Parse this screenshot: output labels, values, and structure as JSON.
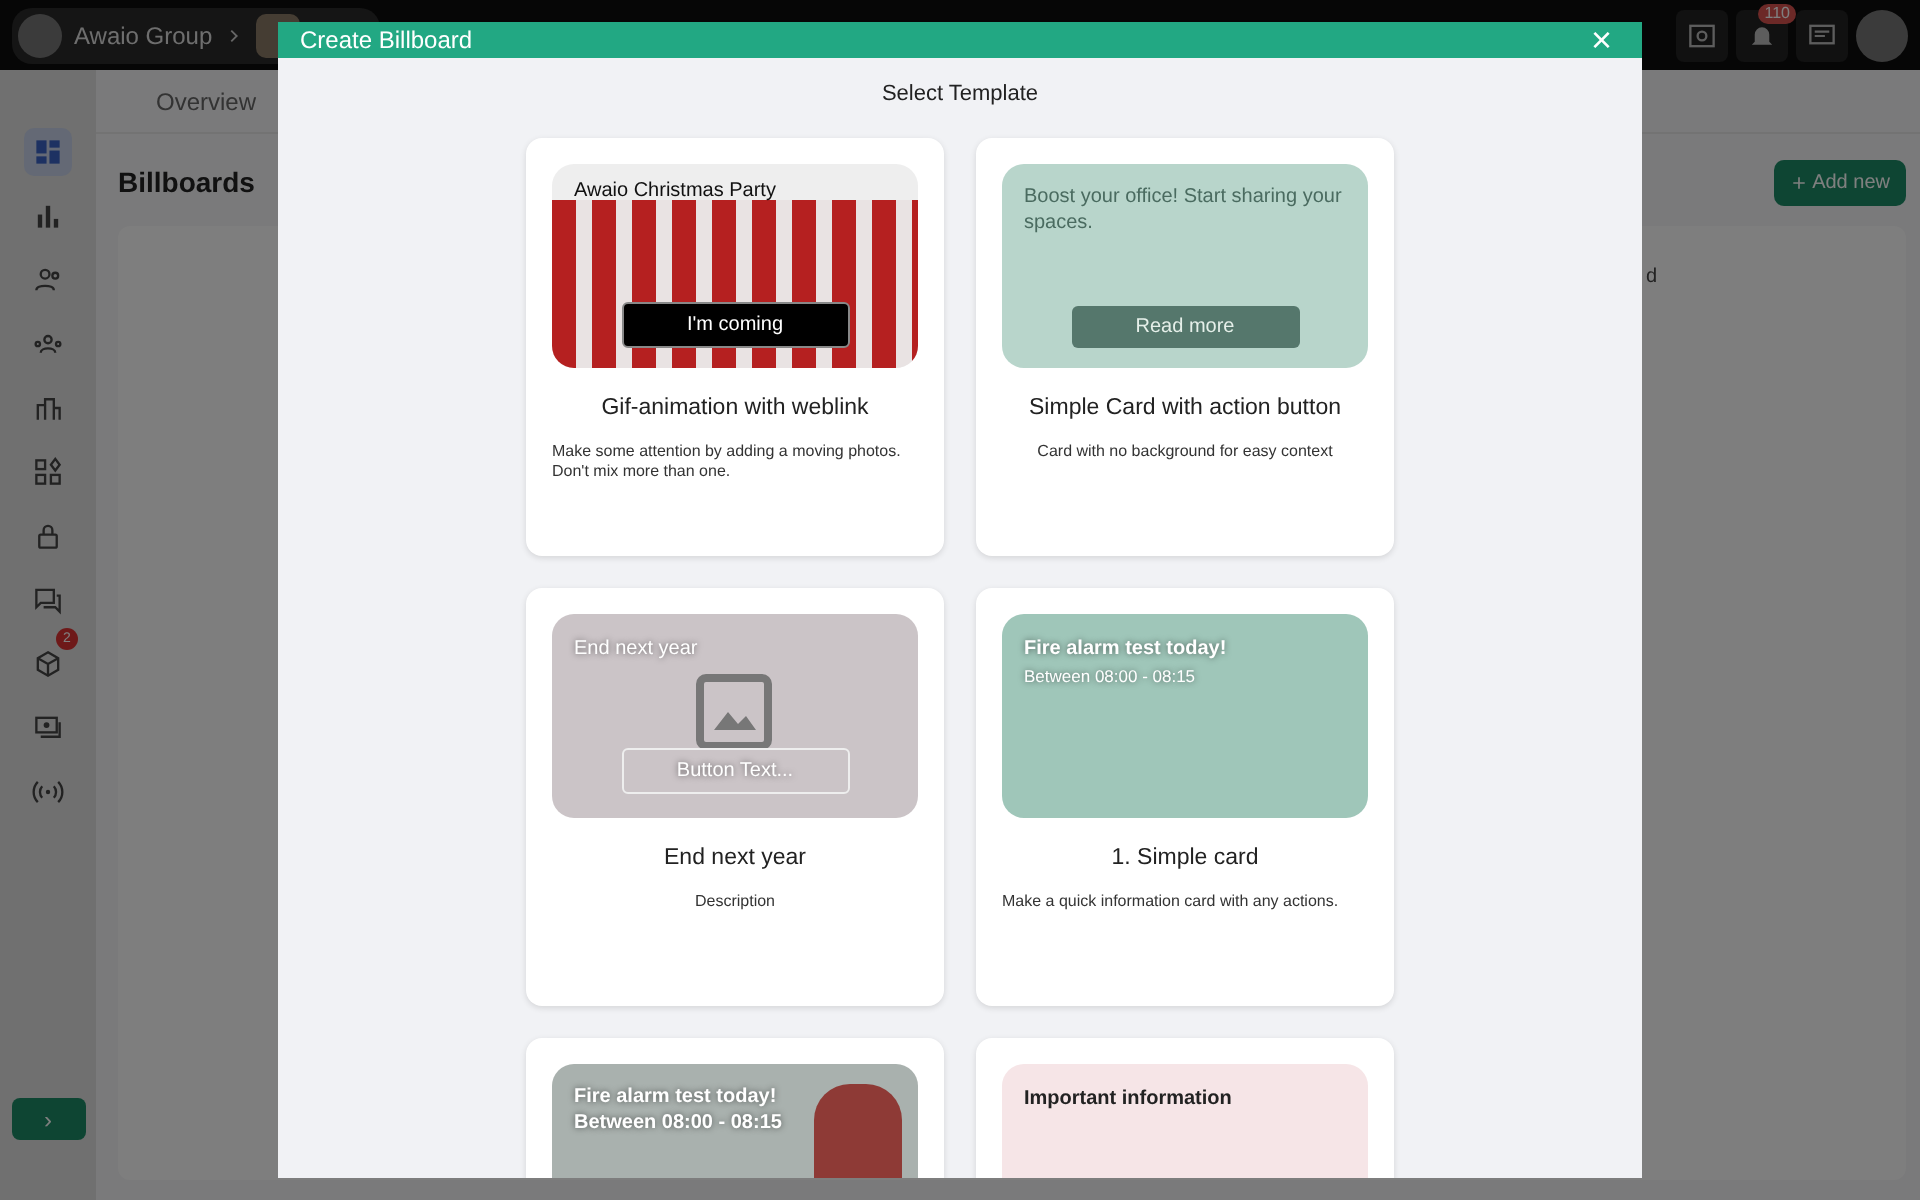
{
  "topbar": {
    "breadcrumb": [
      "Awaio Group"
    ],
    "notifications_badge": "110"
  },
  "sidebar": {
    "items": [
      {
        "selected": true
      },
      {
        "selected": false
      },
      {
        "selected": false
      },
      {
        "selected": false
      },
      {
        "selected": false
      },
      {
        "selected": false
      },
      {
        "selected": false
      },
      {
        "selected": false
      },
      {
        "selected": false,
        "badge": "2"
      },
      {
        "selected": false
      },
      {
        "selected": false
      }
    ],
    "expand_button": "›"
  },
  "page": {
    "tabs": [
      {
        "label": "Overview",
        "selected": false
      }
    ],
    "title": "Billboards",
    "add_button": "Add new",
    "table_header": "d"
  },
  "modal": {
    "title": "Create Billboard",
    "close": "×",
    "subtitle": "Select Template",
    "templates": [
      {
        "kind": "photo",
        "preview_title": "Awaio Christmas Party",
        "preview_button": "I'm coming",
        "title": "Gif-animation with weblink",
        "description": "Make some attention by adding a moving photos. Don't mix more than one."
      },
      {
        "kind": "action",
        "preview_title": "Boost your office! Start sharing your spaces.",
        "preview_button": "Read more",
        "title": "Simple Card with action button",
        "description": "Card with no background for easy context"
      },
      {
        "kind": "image",
        "preview_title": "End next year",
        "preview_button": "Button Text...",
        "title": "End next year",
        "description": "Description"
      },
      {
        "kind": "simple",
        "preview_title": "Fire alarm test today!",
        "preview_subtitle": "Between 08:00 - 08:15",
        "title": "1. Simple card",
        "description": "Make a quick information card with any actions."
      },
      {
        "kind": "photo_side",
        "preview_title": "Fire alarm test today! Between 08:00 - 08:15"
      },
      {
        "kind": "pink",
        "preview_title": "Important information"
      }
    ]
  }
}
